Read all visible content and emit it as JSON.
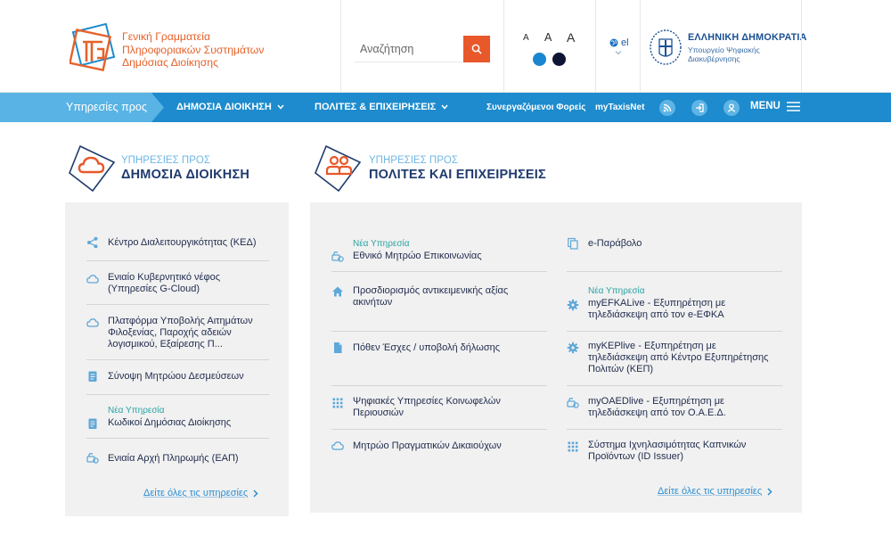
{
  "header": {
    "logo_lines": [
      "Γενική Γραμματεία",
      "Πληροφοριακών Συστημάτων",
      "Δημόσιας Διοίκησης"
    ],
    "search": {
      "placeholder": "Αναζήτηση"
    },
    "font_sizes": [
      "A",
      "A",
      "A"
    ],
    "contrast_colors": [
      "#1a86cf",
      "#0d1533"
    ],
    "language": "el",
    "gov_title": "ΕΛΛΗΝΙΚΗ ΔΗΜΟΚΡΑΤΙΑ",
    "gov_sub_lines": [
      "Υπουργείο Ψηφιακής",
      "Διακυβέρνησης"
    ]
  },
  "nav": {
    "lead": "Υπηρεσίες προς",
    "public_admin": "ΔΗΜΟΣΙΑ ΔΙΟΙΚΗΣΗ",
    "citizens": "ΠΟΛΙΤΕΣ & ΕΠΙΧΕΙΡΗΣΕΙΣ",
    "partners": "Συνεργαζόμενοι Φορείς",
    "mytaxisnet": "myTaxisNet",
    "menu": "MENU"
  },
  "left_section": {
    "sup": "ΥΠΗΡΕΣΙΕΣ ΠΡΟΣ",
    "title": "ΔΗΜΟΣΙΑ ΔΙΟΙΚΗΣΗ",
    "items": [
      {
        "icon": "share-icon",
        "lines": [
          "Κέντρο Διαλειτουργικότητας (ΚΕΔ)"
        ],
        "new": ""
      },
      {
        "icon": "cloud-icon",
        "lines": [
          "Ενιαίο Κυβερνητικό νέφος",
          "(Υπηρεσίες G-Cloud)"
        ],
        "new": ""
      },
      {
        "icon": "cloud-icon",
        "lines": [
          "Πλατφόρμα Υποβολής Αιτημάτων",
          "Φιλοξενίας, Παροχής αδειών",
          "λογισμικού, Εξαίρεσης Π..."
        ],
        "new": ""
      },
      {
        "icon": "document-icon",
        "lines": [
          "Σύνοψη Μητρώου Δεσμεύσεων"
        ],
        "new": ""
      },
      {
        "icon": "document-icon",
        "lines": [
          "Κωδικοί Δημόσιας Διοίκησης"
        ],
        "new": "Νέα Υπηρεσία"
      },
      {
        "icon": "payment-icon",
        "lines": [
          "Ενιαία Αρχή Πληρωμής (ΕΑΠ)"
        ],
        "new": ""
      }
    ],
    "see_all": "Δείτε όλες τις υπηρεσίες"
  },
  "right_section": {
    "sup": "ΥΠΗΡΕΣΙΕΣ ΠΡΟΣ",
    "title": "ΠΟΛΙΤΕΣ ΚΑΙ ΕΠΙΧΕΙΡΗΣΕΙΣ",
    "col1": [
      {
        "icon": "payment-icon",
        "lines": [
          "Εθνικό Μητρώο Επικοινωνίας"
        ],
        "new": "Νέα Υπηρεσία"
      },
      {
        "icon": "home-icon",
        "lines": [
          "Προσδιορισμός αντικειμενικής αξίας",
          "ακινήτων"
        ],
        "new": ""
      },
      {
        "icon": "file-icon",
        "lines": [
          "Πόθεν Έσχες / υποβολή δήλωσης"
        ],
        "new": ""
      },
      {
        "icon": "grid-icon",
        "lines": [
          "Ψηφιακές Υπηρεσίες Κοινωφελών",
          "Περιουσιών"
        ],
        "new": ""
      },
      {
        "icon": "cloud-icon",
        "lines": [
          "Μητρώο Πραγματικών Δικαιούχων"
        ],
        "new": ""
      }
    ],
    "col2": [
      {
        "icon": "copy-icon",
        "lines": [
          "e-Παράβολο"
        ],
        "new": ""
      },
      {
        "icon": "gear-icon",
        "lines": [
          "myEFKALive - Εξυπηρέτηση με",
          "τηλεδιάσκεψη από τον e-ΕΦΚΑ"
        ],
        "new": "Νέα Υπηρεσία"
      },
      {
        "icon": "gear-icon",
        "lines": [
          "myKEPlive - Εξυπηρέτηση με",
          "τηλεδιάσκεψη από Κέντρο Εξυπηρέτησης",
          "Πολιτών (ΚΕΠ)"
        ],
        "new": ""
      },
      {
        "icon": "payment-icon",
        "lines": [
          "myOAEDlive - Εξυπηρέτηση με",
          "τηλεδιάσκεψη από τον Ο.Α.Ε.Δ."
        ],
        "new": ""
      },
      {
        "icon": "grid-icon",
        "lines": [
          "Σύστημα Ιχνηλασιμότητας Καπνικών",
          "Προϊόντων (ID Issuer)"
        ],
        "new": ""
      }
    ],
    "see_all": "Δείτε όλες τις υπηρεσίες"
  }
}
